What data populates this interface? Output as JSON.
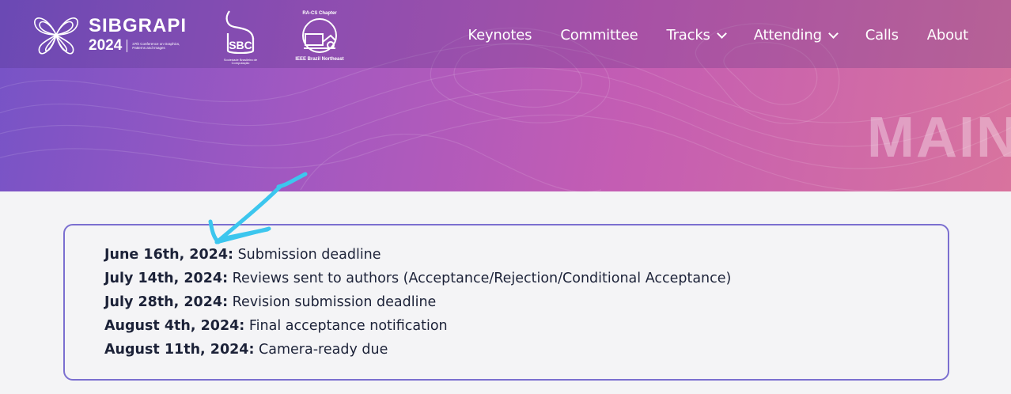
{
  "brand": {
    "name": "SIBGRAPI",
    "year": "2024",
    "subtitle": "37th Conference on Graphics, Patterns and Images",
    "sbc_label": "SBC",
    "sbc_caption": "Sociedade Brasileira de Computação",
    "ras_top": "RA-CS Chapter",
    "ras_bottom": "IEEE Brazil Northeast"
  },
  "nav": {
    "items": [
      {
        "label": "Keynotes",
        "dropdown": false
      },
      {
        "label": "Committee",
        "dropdown": false
      },
      {
        "label": "Tracks",
        "dropdown": true
      },
      {
        "label": "Attending",
        "dropdown": true
      },
      {
        "label": "Calls",
        "dropdown": false
      },
      {
        "label": "About",
        "dropdown": false
      }
    ]
  },
  "hero": {
    "title": "MAIN"
  },
  "dates": [
    {
      "date": "June 16th, 2024:",
      "text": " Submission deadline"
    },
    {
      "date": "July 14th, 2024:",
      "text": " Reviews sent to authors (Acceptance/Rejection/Conditional Acceptance)"
    },
    {
      "date": "July 28th, 2024:",
      "text": " Revision submission deadline"
    },
    {
      "date": "August 4th, 2024:",
      "text": " Final acceptance notification"
    },
    {
      "date": "August 11th, 2024:",
      "text": " Camera-ready due"
    }
  ],
  "colors": {
    "gradient_start": "#7653c6",
    "gradient_end": "#d8739e",
    "box_border": "#7b6fd0",
    "annotation": "#3cc6ee",
    "text": "#1c2238"
  }
}
